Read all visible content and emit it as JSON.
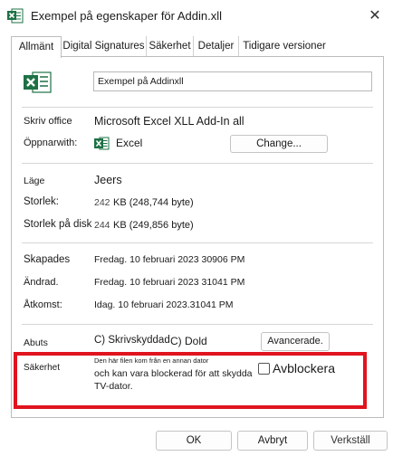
{
  "window": {
    "title": "Exempel på egenskaper för Addin.xll",
    "close_symbol": "✕"
  },
  "tabs": [
    {
      "label": "Allmänt"
    },
    {
      "label": "Digital Signatures"
    },
    {
      "label": "Säkerhet"
    },
    {
      "label": "Detaljer"
    },
    {
      "label": "Tidigare versioner"
    }
  ],
  "general": {
    "file_name": "Exempel på Addinxll",
    "type_label": "Skriv office",
    "type_value": "Microsoft Excel XLL Add-In all",
    "opens_with_label": "Öppnarwith:",
    "opens_with_value": "Excel",
    "change_button": "Change...",
    "location_label": "Läge",
    "location_value": "Jeers",
    "size_label": "Storlek:",
    "size_num": "242",
    "size_rest": "KB (248,744 byte)",
    "size_on_disk_label": "Storlek på disk",
    "size_on_disk_num": "244",
    "size_on_disk_rest": "KB (249,856 byte)",
    "created_label": "Skapades",
    "created_value": "Fredag. 10 februari 2023 30906 PM",
    "modified_label": "Ändrad.",
    "modified_value": "Fredag. 10 februari 2023 31041 PM",
    "accessed_label": "Åtkomst:",
    "accessed_value": "Idag. 10 februari 2023.31041 PM",
    "attributes_label": "Abuts",
    "readonly_label": "C) Skrivskyddad",
    "hidden_label": "C) Dold",
    "advanced_button": "Avancerade.",
    "security_label": "Säkerhet",
    "security_line1": "Den här filen kom från en annan dator",
    "security_line2": "och kan vara blockerad för att skydda",
    "security_line3": "TV-dator.",
    "unblock_label": "Avblockera",
    "unblock_checked": false
  },
  "footer": {
    "ok": "OK",
    "cancel": "Avbryt",
    "apply": "Verkställ"
  },
  "colors": {
    "excel_green": "#1e7145",
    "highlight_red": "#e0141e"
  }
}
